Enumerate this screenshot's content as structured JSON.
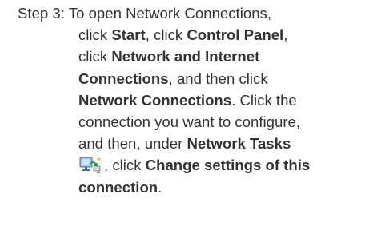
{
  "step": {
    "label": "Step 3:",
    "line1_text": "To open Network Connections,",
    "line2_a": "click ",
    "line2_b": "Start",
    "line2_c": ", click ",
    "line2_d": "Control Panel",
    "line2_e": ",",
    "line3_a": "click ",
    "line3_b": "Network and Internet",
    "line4_a": "Connections",
    "line4_b": ", and then click",
    "line5_a": "Network Connections",
    "line5_b": ". Click the",
    "line6": "connection you want to configure,",
    "line7_a": "and then, under ",
    "line7_b": "Network Tasks",
    "line8_a": ", click ",
    "line8_b": "Change settings of this",
    "line9_a": "connection",
    "line9_b": ".",
    "icon": "network-connections-icon"
  }
}
